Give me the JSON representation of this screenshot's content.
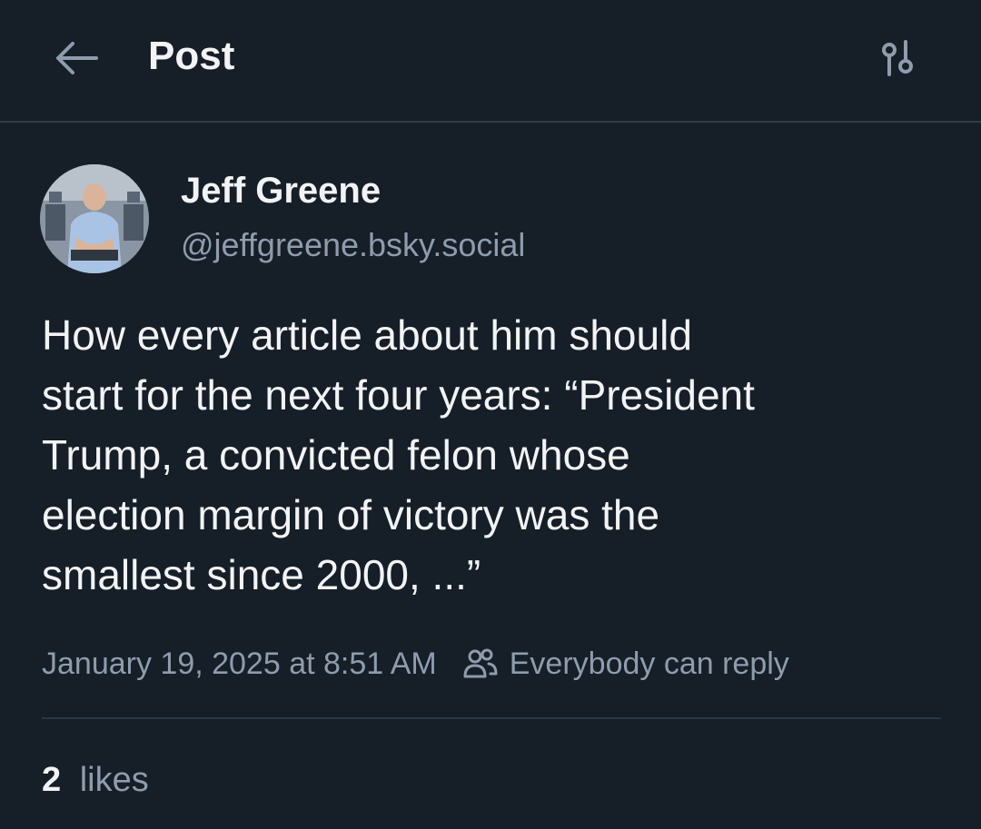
{
  "header": {
    "title": "Post",
    "back_icon": "arrow-left-icon",
    "settings_icon": "sliders-icon"
  },
  "author": {
    "display_name": "Jeff Greene",
    "handle": "@jeffgreene.bsky.social",
    "avatar_icon": "avatar-photo"
  },
  "post": {
    "text": "How every article about him should\nstart for the next four years: “President\nTrump, a convicted felon whose\nelection margin of victory was the\nsmallest since 2000, ...”",
    "timestamp": "January 19, 2025 at 8:51 AM",
    "reply_setting": "Everybody can reply",
    "reply_icon": "people-icon"
  },
  "stats": {
    "likes_count": "2",
    "likes_label": "likes"
  },
  "colors": {
    "background": "#161e27",
    "text_primary": "#f1f3f5",
    "text_secondary": "#8e9cad",
    "border": "#2e3d4c"
  }
}
